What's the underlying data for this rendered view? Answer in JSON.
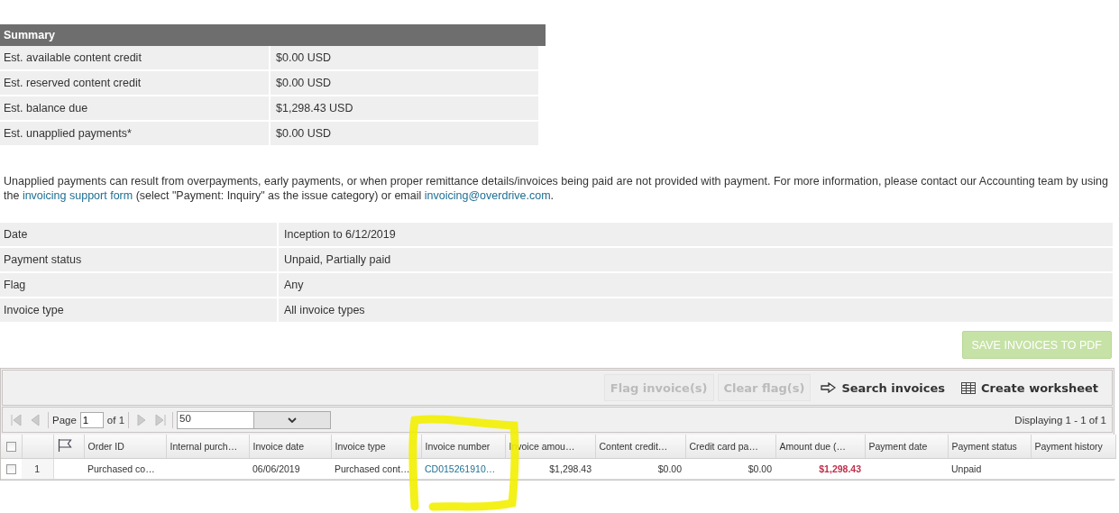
{
  "summary": {
    "title": "Summary",
    "rows": [
      {
        "label": "Est. available content credit",
        "value": "$0.00 USD"
      },
      {
        "label": "Est. reserved content credit",
        "value": "$0.00 USD"
      },
      {
        "label": "Est. balance due",
        "value": "$1,298.43 USD"
      },
      {
        "label": "Est. unapplied payments*",
        "value": "$0.00 USD"
      }
    ]
  },
  "footnote": {
    "text_before": "Unapplied payments can result from overpayments, early payments, or when proper remittance details/invoices being paid are not provided with payment. For more information, please contact our Accounting team by using the",
    "link": "invoicing support form",
    "text_middle": "(select \"Payment: Inquiry\" as the issue category) or email",
    "email": "invoicing@overdrive.com",
    "text_after": "."
  },
  "filters": [
    {
      "label": "Date",
      "value": "Inception to 6/12/2019"
    },
    {
      "label": "Payment status",
      "value": "Unpaid, Partially paid"
    },
    {
      "label": "Flag",
      "value": "Any"
    },
    {
      "label": "Invoice type",
      "value": "All invoice types"
    }
  ],
  "save_button": {
    "label": "SAVE INVOICES TO PDF",
    "disabled": true
  },
  "grid": {
    "toolbar": [
      {
        "kind": "plain",
        "label": "Flag invoice(s)",
        "disabled": true
      },
      {
        "kind": "plain",
        "label": "Clear flag(s)",
        "disabled": true
      },
      {
        "kind": "search",
        "label": "Search invoices",
        "disabled": false
      },
      {
        "kind": "worksheet",
        "label": "Create worksheet",
        "disabled": false
      }
    ],
    "paging": {
      "page_label": "Page",
      "page": "1",
      "of": "of 1",
      "page_size": "50",
      "displaying": "Displaying 1 - 1 of 1"
    },
    "header_checked": false,
    "columns": [
      "Order ID",
      "Internal purch…",
      "Invoice date",
      "Invoice type",
      "Invoice number",
      "Invoice amou…",
      "Content credit…",
      "Credit card pa…",
      "Amount due (…",
      "Payment date",
      "Payment status",
      "Payment history"
    ],
    "rows": [
      {
        "checked": false,
        "number": "1",
        "cells": [
          {
            "kind": "text",
            "text": "Purchased co…"
          },
          {
            "kind": "empty"
          },
          {
            "kind": "text",
            "text": "06/06/2019"
          },
          {
            "kind": "text",
            "text": "Purchased cont…"
          },
          {
            "kind": "link",
            "text": "CD015261910…"
          },
          {
            "kind": "number",
            "text": "$1,298.43"
          },
          {
            "kind": "number",
            "text": "$0.00"
          },
          {
            "kind": "number",
            "text": "$0.00"
          },
          {
            "kind": "due",
            "text": "$1,298.43"
          },
          {
            "kind": "empty"
          },
          {
            "kind": "text",
            "text": "Unpaid"
          },
          {
            "kind": "empty"
          }
        ]
      }
    ]
  }
}
